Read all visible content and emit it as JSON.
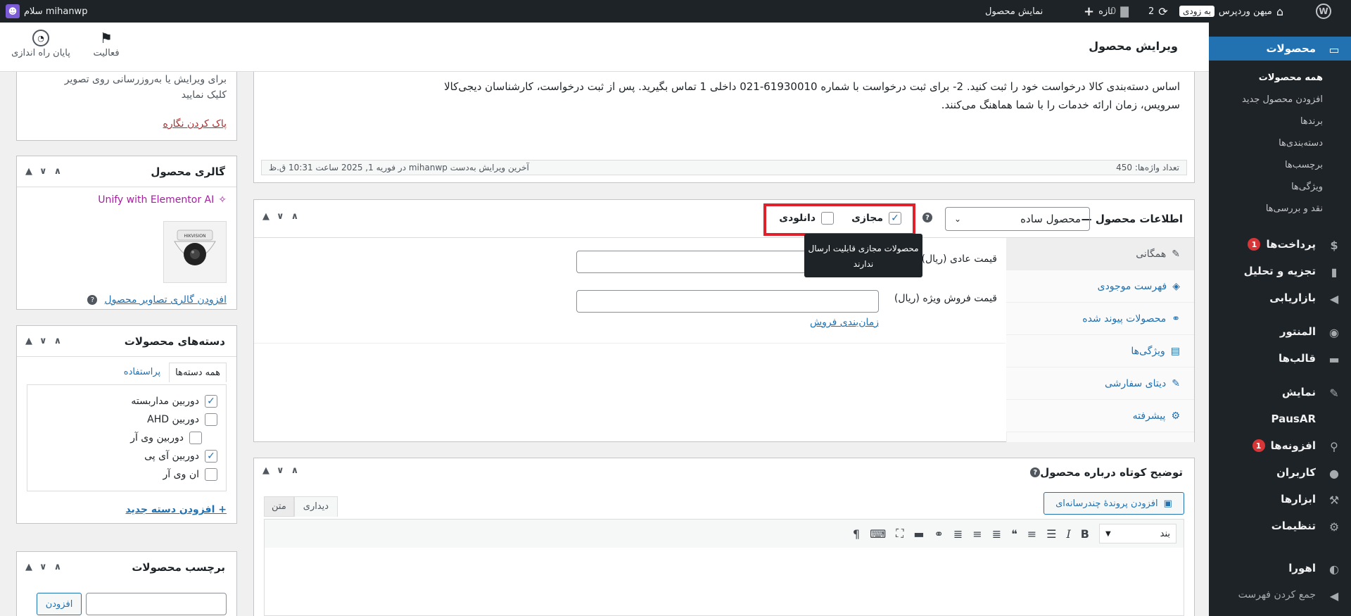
{
  "admin_bar": {
    "site_name": "میهن وردپرس",
    "soon_badge": "به زودی",
    "updates_count": "2",
    "comments_count": "0",
    "new_label": "تازه",
    "view_product": "نمایش محصول",
    "greeting": "سلام mihanwp"
  },
  "sidebar": {
    "products_label": "محصولات",
    "sub_items": [
      "همه محصولات",
      "افزودن محصول جدید",
      "برندها",
      "دسته‌بندی‌ها",
      "برچسب‌ها",
      "ویژگی‌ها",
      "نقد و بررسی‌ها"
    ],
    "payments_label": "پرداخت‌ها",
    "payments_badge": "1",
    "analytics_label": "تجزیه و تحلیل",
    "marketing_label": "بازاریابی",
    "elementor_label": "المنتور",
    "templates_label": "قالب‌ها",
    "appearance_label": "نمایش",
    "pausar_label": "PausAR",
    "plugins_label": "افزونه‌ها",
    "plugins_badge": "1",
    "users_label": "کاربران",
    "tools_label": "ابزارها",
    "settings_label": "تنظیمات",
    "ahura_label": "اهورا",
    "collapse_label": "جمع کردن فهرست"
  },
  "topbar": {
    "page_title": "ویرایش محصول",
    "activity_label": "فعالیت",
    "finish_setup_label": "پایان راه اندازی"
  },
  "editor": {
    "content_line1": "اساس دسته‌بندی کالا درخواست خود را ثبت کنید. 2- برای ثبت درخواست با شماره 61930010-021 داخلی 1 تماس بگیرید. پس از ثبت درخواست، کارشناسان دیجی‌کالا",
    "content_line2": "سرویس، زمان ارائه خدمات را با شما هماهنگ می‌کنند.",
    "word_count": "تعداد واژه‌ها: 450",
    "last_edit": "آخرین ویرایش به‌دست mihanwp در فوریه 1, 2025 ساعت 10:31 ق.ظ"
  },
  "product_data": {
    "title": "اطلاعات محصول —",
    "product_type": "محصول ساده",
    "virtual_label": "مجازی",
    "downloadable_label": "دانلودی",
    "tooltip_line1": "محصولات مجازی قابلیت ارسال",
    "tooltip_line2": "ندارند",
    "tabs": [
      "همگانی",
      "فهرست موجودی",
      "محصولات پیوند شده",
      "ویژگی‌ها",
      "دیتای سفارشی",
      "پیشرفته"
    ],
    "regular_price_label": "قیمت عادی (ریال)",
    "sale_price_label": "قیمت فروش ویژه (ریال)",
    "schedule_link": "زمان‌بندی فروش"
  },
  "short_desc": {
    "title": "توضیح کوتاه درباره محصول",
    "add_media": "افزودن پروندهٔ چندرسانه‌ای",
    "tab_visual": "دیداری",
    "tab_text": "متن",
    "format_select": "بند"
  },
  "image_box": {
    "hint_line1": "برای ویرایش یا به‌روزرسانی روی تصویر",
    "hint_line2": "کلیک نمایید",
    "remove_link": "پاک کردن نگاره"
  },
  "gallery": {
    "title": "گالری محصول",
    "unify": "Unify with Elementor AI",
    "add_link": "افزودن گالری تصاویر محصول"
  },
  "categories": {
    "title": "دسته‌های محصولات",
    "tab_all": "همه دسته‌ها",
    "tab_popular": "پراستفاده",
    "items": [
      {
        "label": "دوربین مداربسته",
        "checked": true
      },
      {
        "label": "دوربین AHD",
        "checked": false
      },
      {
        "label": "دوربین وی آر",
        "checked": false
      },
      {
        "label": "دوربین آی پی",
        "checked": true
      },
      {
        "label": "ان وی آر",
        "checked": false
      }
    ],
    "add_link": "+ افزودن دسته جدید"
  },
  "tags": {
    "title": "برچسب محصولات",
    "add_button": "افزودن"
  },
  "colors": {
    "admin_dark": "#1d2327",
    "accent": "#2271b1",
    "highlight": "#d63638"
  }
}
